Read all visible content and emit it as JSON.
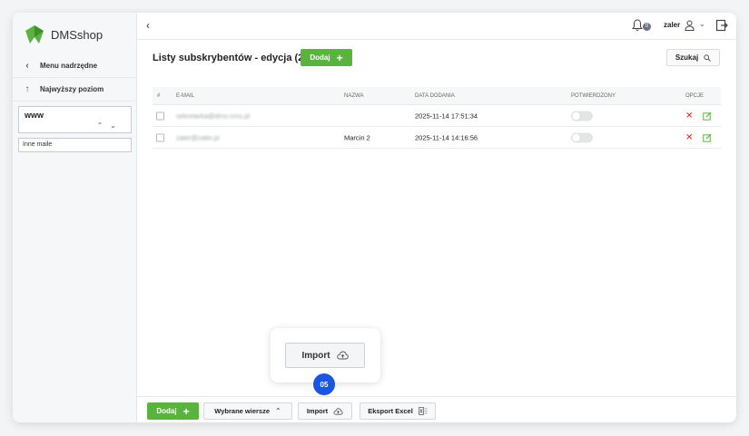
{
  "app": {
    "name": "DMSshop",
    "brand_color": "#5ab23f"
  },
  "sidebar": {
    "items": [
      {
        "label": "Menu nadrzędne",
        "icon": "chevron-left-icon"
      },
      {
        "label": "Najwyższy poziom",
        "icon": "arrow-up-icon"
      }
    ],
    "select_value": "www",
    "list_item": "Inne maile"
  },
  "topbar": {
    "notification_count": "0",
    "user_name": "zaler"
  },
  "page": {
    "title": "Listy subskrybentów - edycja (2)",
    "add_label": "Dodaj",
    "search_label": "Szukaj"
  },
  "table": {
    "columns": [
      "#",
      "E-MAIL",
      "NAZWA",
      "DATA DODANIA",
      "POTWIERDZONY",
      "OPCJE"
    ],
    "rows": [
      {
        "email": "sekretarka@dms-cms.pl",
        "name": "",
        "date": "2025-11-14 17:51:34",
        "confirmed": false
      },
      {
        "email": "zaler@zaler.pl",
        "name": "Marcin 2",
        "date": "2025-11-14 14:16:56",
        "confirmed": false
      }
    ]
  },
  "popup": {
    "import_label": "Import",
    "step": "05"
  },
  "footer": {
    "add_label": "Dodaj",
    "selected_rows_label": "Wybrane wiersze",
    "import_label": "Import",
    "export_label": "Eksport Excel"
  },
  "colors": {
    "accent_blue": "#1a56e0",
    "danger": "#e0201b"
  }
}
